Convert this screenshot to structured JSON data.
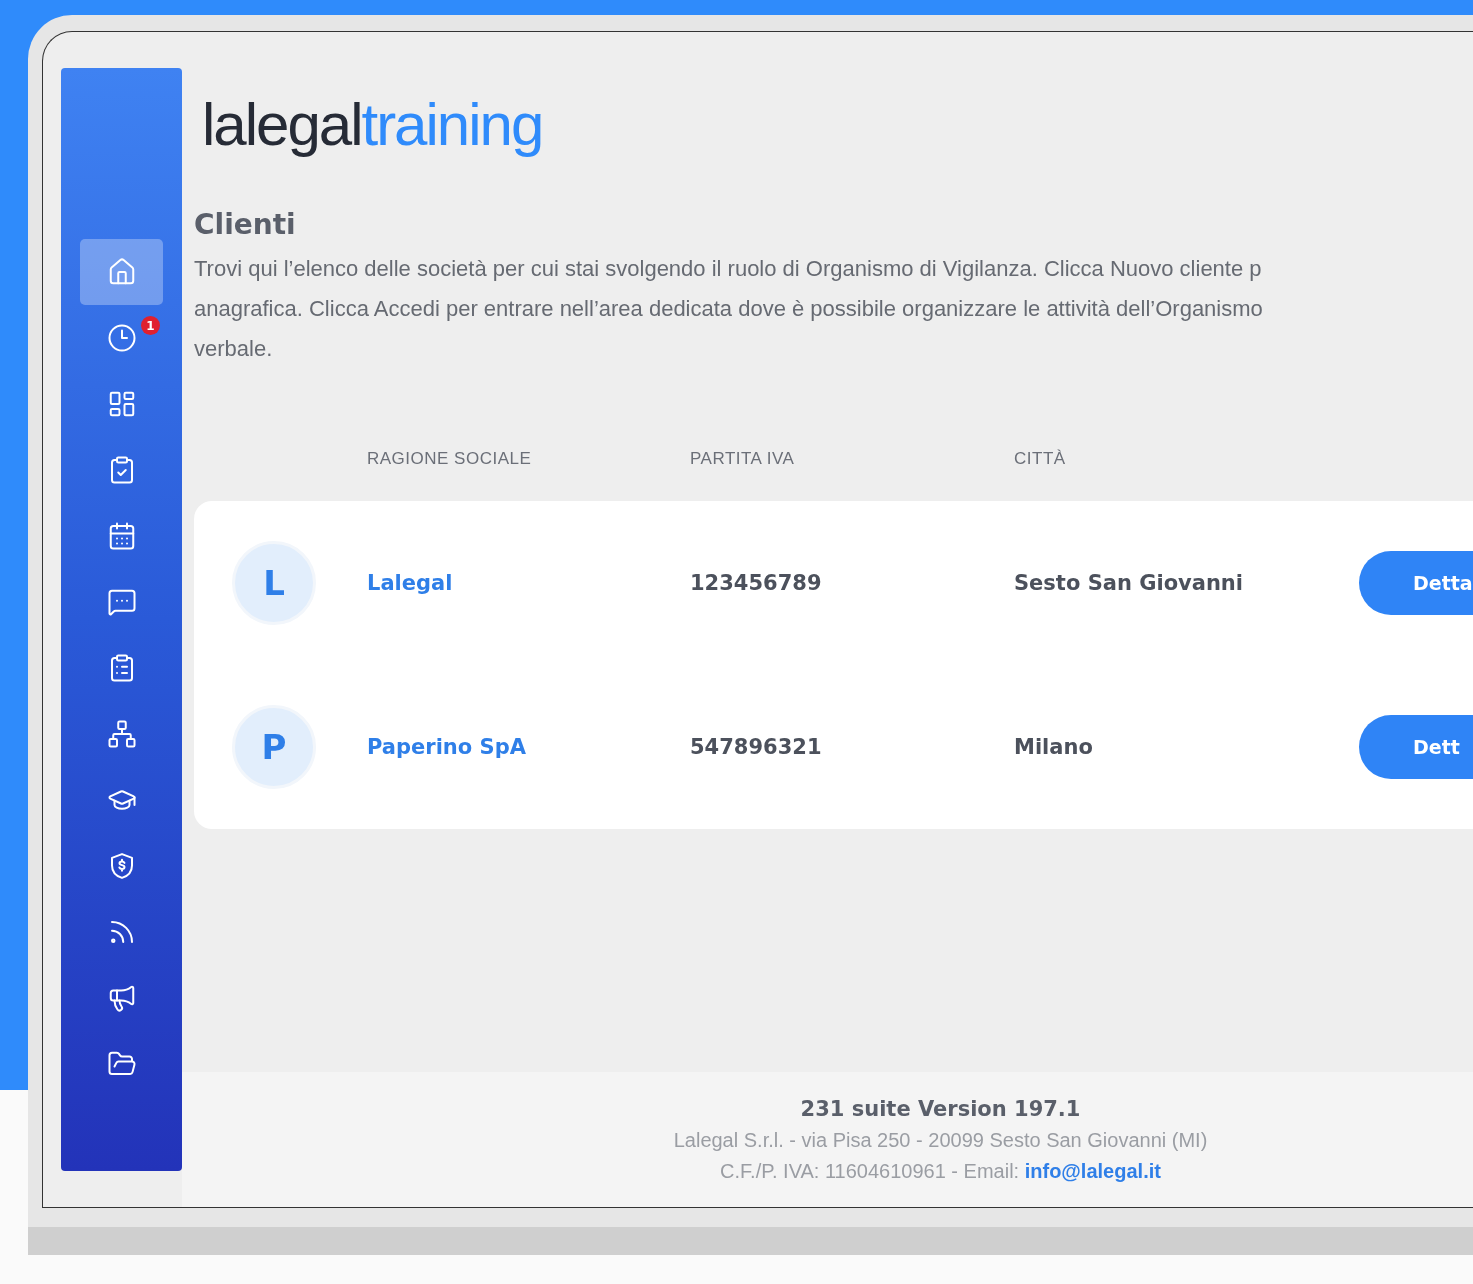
{
  "logo": {
    "dark_part": "lalegal",
    "light_part": "training"
  },
  "sidebar": {
    "items": [
      {
        "selected": true
      },
      {
        "selected": false,
        "badge": "1"
      },
      {
        "selected": false
      },
      {
        "selected": false
      },
      {
        "selected": false
      },
      {
        "selected": false
      },
      {
        "selected": false
      },
      {
        "selected": false
      },
      {
        "selected": false
      },
      {
        "selected": false
      },
      {
        "selected": false
      },
      {
        "selected": false
      },
      {
        "selected": false
      }
    ]
  },
  "page": {
    "title": "Clienti",
    "description_lines": [
      "Trovi qui l’elenco delle società per cui stai svolgendo il ruolo di Organismo di Vigilanza. Clicca Nuovo cliente p",
      "anagrafica. Clicca Accedi per entrare nell’area dedicata dove è possibile organizzare le attività dell’Organismo",
      "verbale."
    ]
  },
  "table": {
    "columns": [
      "RAGIONE SOCIALE",
      "PARTITA IVA",
      "CITTÀ"
    ],
    "rows": [
      {
        "initial": "L",
        "name": "Lalegal",
        "vat": "123456789",
        "city": "Sesto San Giovanni",
        "button": "Detta"
      },
      {
        "initial": "P",
        "name": "Paperino SpA",
        "vat": "547896321",
        "city": "Milano",
        "button": "Dett"
      }
    ]
  },
  "footer": {
    "version": "231 suite Version 197.1",
    "address": "Lalegal S.r.l. - via Pisa 250 - 20099 Sesto San Giovanni (MI)",
    "fiscal_text": "C.F./P. IVA: 11604610961 - Email: ",
    "email": "info@lalegal.it"
  }
}
